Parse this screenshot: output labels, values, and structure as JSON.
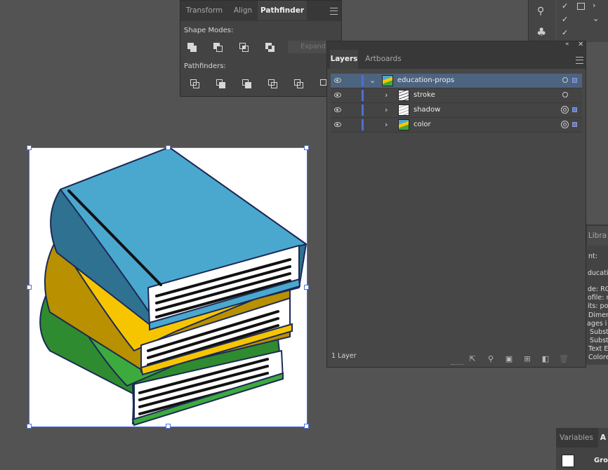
{
  "pathfinder_panel": {
    "tabs": [
      {
        "label": "Transform"
      },
      {
        "label": "Align"
      },
      {
        "label": "Pathfinder"
      }
    ],
    "shape_modes_label": "Shape Modes:",
    "pathfinders_label": "Pathfinders:",
    "expand_label": "Expand"
  },
  "layers_panel": {
    "tabs": [
      {
        "label": "Layers"
      },
      {
        "label": "Artboards"
      }
    ],
    "rows": [
      {
        "name": "education-props"
      },
      {
        "name": "stroke"
      },
      {
        "name": "shadow"
      },
      {
        "name": "color"
      }
    ],
    "footer_count": "1 Layer"
  },
  "right_panel": {
    "library_tab": "Libra",
    "doc_lines": [
      "nt:",
      "ducation",
      "de: RG",
      "ofile: no",
      "its: poi",
      "Dimer",
      "ages i",
      "Subst",
      "Subst",
      "Text E",
      "Colore"
    ],
    "bottom_tabs": [
      {
        "label": "Variables"
      },
      {
        "label": "A"
      }
    ],
    "bottom_item": "Gro"
  },
  "colors": {
    "book_blue": "#4aa8cf",
    "book_yellow": "#f7c500",
    "book_green": "#3daa3d",
    "selection": "#4f6fd8",
    "panel_bg": "#434343"
  }
}
